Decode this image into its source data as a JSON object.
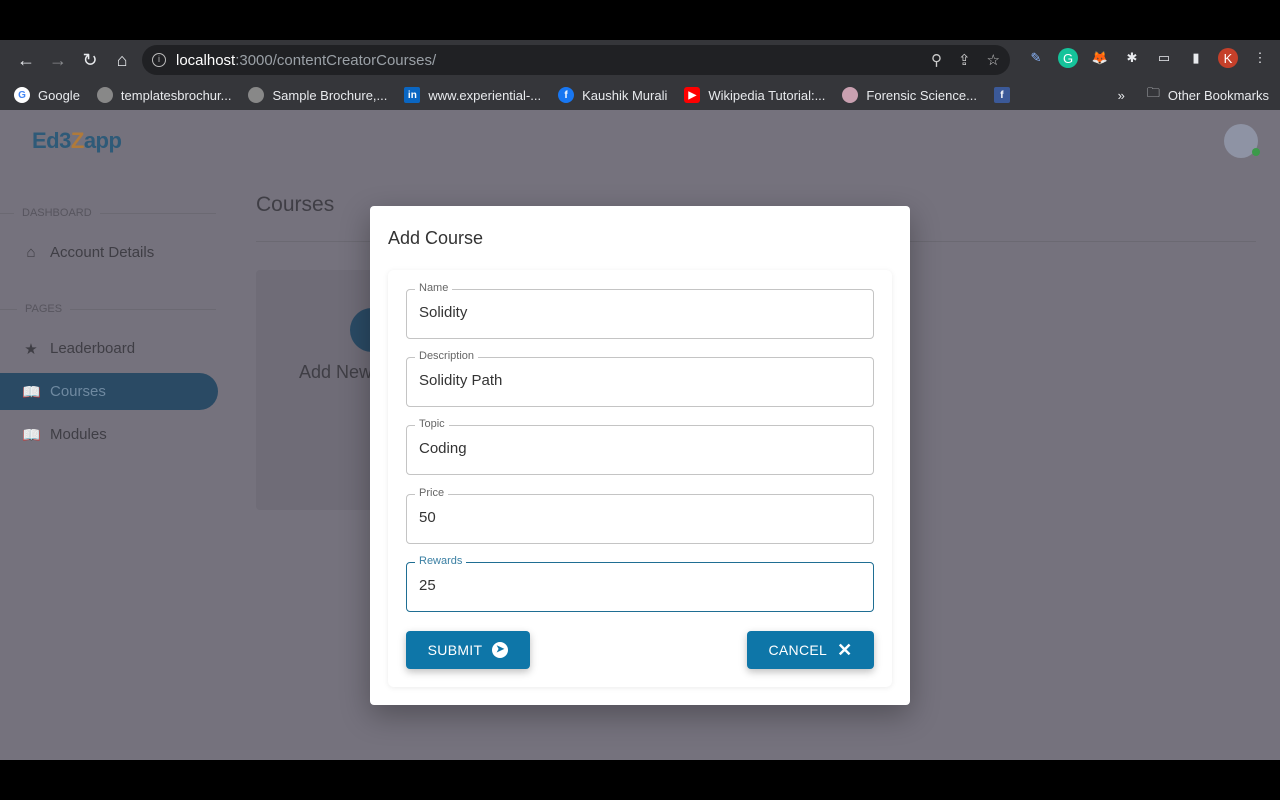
{
  "browser": {
    "url_host": "localhost",
    "url_path": ":3000/contentCreatorCourses/",
    "profile_initial": "K",
    "bookmarks": [
      {
        "label": "Google",
        "icon": "google-icon"
      },
      {
        "label": "templatesbrochur...",
        "icon": "globe-icon"
      },
      {
        "label": "Sample Brochure,...",
        "icon": "globe-icon"
      },
      {
        "label": "www.experiential-...",
        "icon": "linkedin-icon"
      },
      {
        "label": "Kaushik Murali",
        "icon": "facebook-icon"
      },
      {
        "label": "Wikipedia Tutorial:...",
        "icon": "youtube-icon"
      },
      {
        "label": "Forensic Science...",
        "icon": "seal-icon"
      },
      {
        "label": "",
        "icon": "facebook-icon"
      }
    ],
    "other_bookmarks": "Other Bookmarks"
  },
  "app": {
    "logo": "Ed3Zapp",
    "logo_a": "Ed3",
    "logo_z": "Z",
    "logo_b": "app"
  },
  "sidebar": {
    "sections": [
      {
        "label": "DASHBOARD"
      },
      {
        "label": "PAGES"
      }
    ],
    "items": [
      {
        "label": "Account Details",
        "icon": "home-icon"
      },
      {
        "label": "Leaderboard",
        "icon": "trophy-icon"
      },
      {
        "label": "Courses",
        "icon": "book-icon",
        "active": true
      },
      {
        "label": "Modules",
        "icon": "book-icon"
      }
    ]
  },
  "main": {
    "title": "Courses",
    "card_label": "Add New"
  },
  "modal": {
    "title": "Add Course",
    "fields": [
      {
        "label": "Name",
        "value": "Solidity"
      },
      {
        "label": "Description",
        "value": "Solidity Path"
      },
      {
        "label": "Topic",
        "value": "Coding"
      },
      {
        "label": "Price",
        "value": "50"
      },
      {
        "label": "Rewards",
        "value": "25",
        "focused": true
      }
    ],
    "submit_label": "SUBMIT",
    "cancel_label": "CANCEL"
  },
  "colors": {
    "primary": "#0e76a8",
    "overlay_bg": "#75727d"
  }
}
